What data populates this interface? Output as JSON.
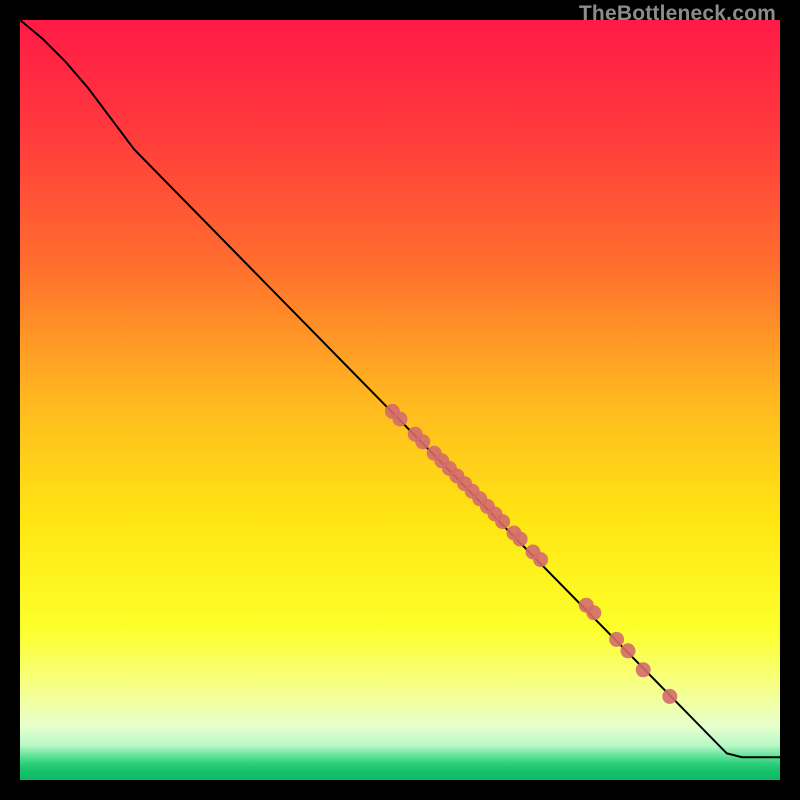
{
  "watermark": "TheBottleneck.com",
  "chart_data": {
    "type": "line",
    "title": "",
    "xlabel": "",
    "ylabel": "",
    "xlim": [
      0,
      100
    ],
    "ylim": [
      0,
      100
    ],
    "grid": false,
    "legend": false,
    "background_gradient": {
      "stops": [
        {
          "offset": 0.0,
          "color": "#ff1a47"
        },
        {
          "offset": 0.15,
          "color": "#ff3a3c"
        },
        {
          "offset": 0.32,
          "color": "#ff6d2e"
        },
        {
          "offset": 0.5,
          "color": "#ffb820"
        },
        {
          "offset": 0.66,
          "color": "#ffe612"
        },
        {
          "offset": 0.8,
          "color": "#fcff2a"
        },
        {
          "offset": 0.88,
          "color": "#f6ff8a"
        },
        {
          "offset": 0.93,
          "color": "#e7ffce"
        },
        {
          "offset": 0.955,
          "color": "#b6f7c6"
        },
        {
          "offset": 0.968,
          "color": "#63e29a"
        },
        {
          "offset": 0.978,
          "color": "#2fd07d"
        },
        {
          "offset": 0.988,
          "color": "#17c06b"
        },
        {
          "offset": 1.0,
          "color": "#0fb964"
        }
      ]
    },
    "series": [
      {
        "name": "curve",
        "type": "line",
        "color": "#000000",
        "points": [
          {
            "x": 0.0,
            "y": 100.0
          },
          {
            "x": 3.0,
            "y": 97.5
          },
          {
            "x": 6.0,
            "y": 94.5
          },
          {
            "x": 9.0,
            "y": 91.0
          },
          {
            "x": 12.0,
            "y": 87.0
          },
          {
            "x": 15.0,
            "y": 83.0
          },
          {
            "x": 93.0,
            "y": 3.5
          },
          {
            "x": 95.0,
            "y": 3.0
          },
          {
            "x": 100.0,
            "y": 3.0
          }
        ]
      },
      {
        "name": "dots",
        "type": "scatter",
        "color": "#d46b6b",
        "points": [
          {
            "x": 49.0,
            "y": 48.5
          },
          {
            "x": 50.0,
            "y": 47.5
          },
          {
            "x": 52.0,
            "y": 45.5
          },
          {
            "x": 53.0,
            "y": 44.5
          },
          {
            "x": 54.5,
            "y": 43.0
          },
          {
            "x": 55.5,
            "y": 42.0
          },
          {
            "x": 56.5,
            "y": 41.0
          },
          {
            "x": 57.5,
            "y": 40.0
          },
          {
            "x": 58.5,
            "y": 39.0
          },
          {
            "x": 59.5,
            "y": 38.0
          },
          {
            "x": 60.5,
            "y": 37.0
          },
          {
            "x": 61.5,
            "y": 36.0
          },
          {
            "x": 62.5,
            "y": 35.0
          },
          {
            "x": 63.5,
            "y": 34.0
          },
          {
            "x": 65.0,
            "y": 32.5
          },
          {
            "x": 65.8,
            "y": 31.7
          },
          {
            "x": 67.5,
            "y": 30.0
          },
          {
            "x": 68.5,
            "y": 29.0
          },
          {
            "x": 74.5,
            "y": 23.0
          },
          {
            "x": 75.5,
            "y": 22.0
          },
          {
            "x": 78.5,
            "y": 18.5
          },
          {
            "x": 80.0,
            "y": 17.0
          },
          {
            "x": 82.0,
            "y": 14.5
          },
          {
            "x": 85.5,
            "y": 11.0
          }
        ]
      }
    ]
  }
}
